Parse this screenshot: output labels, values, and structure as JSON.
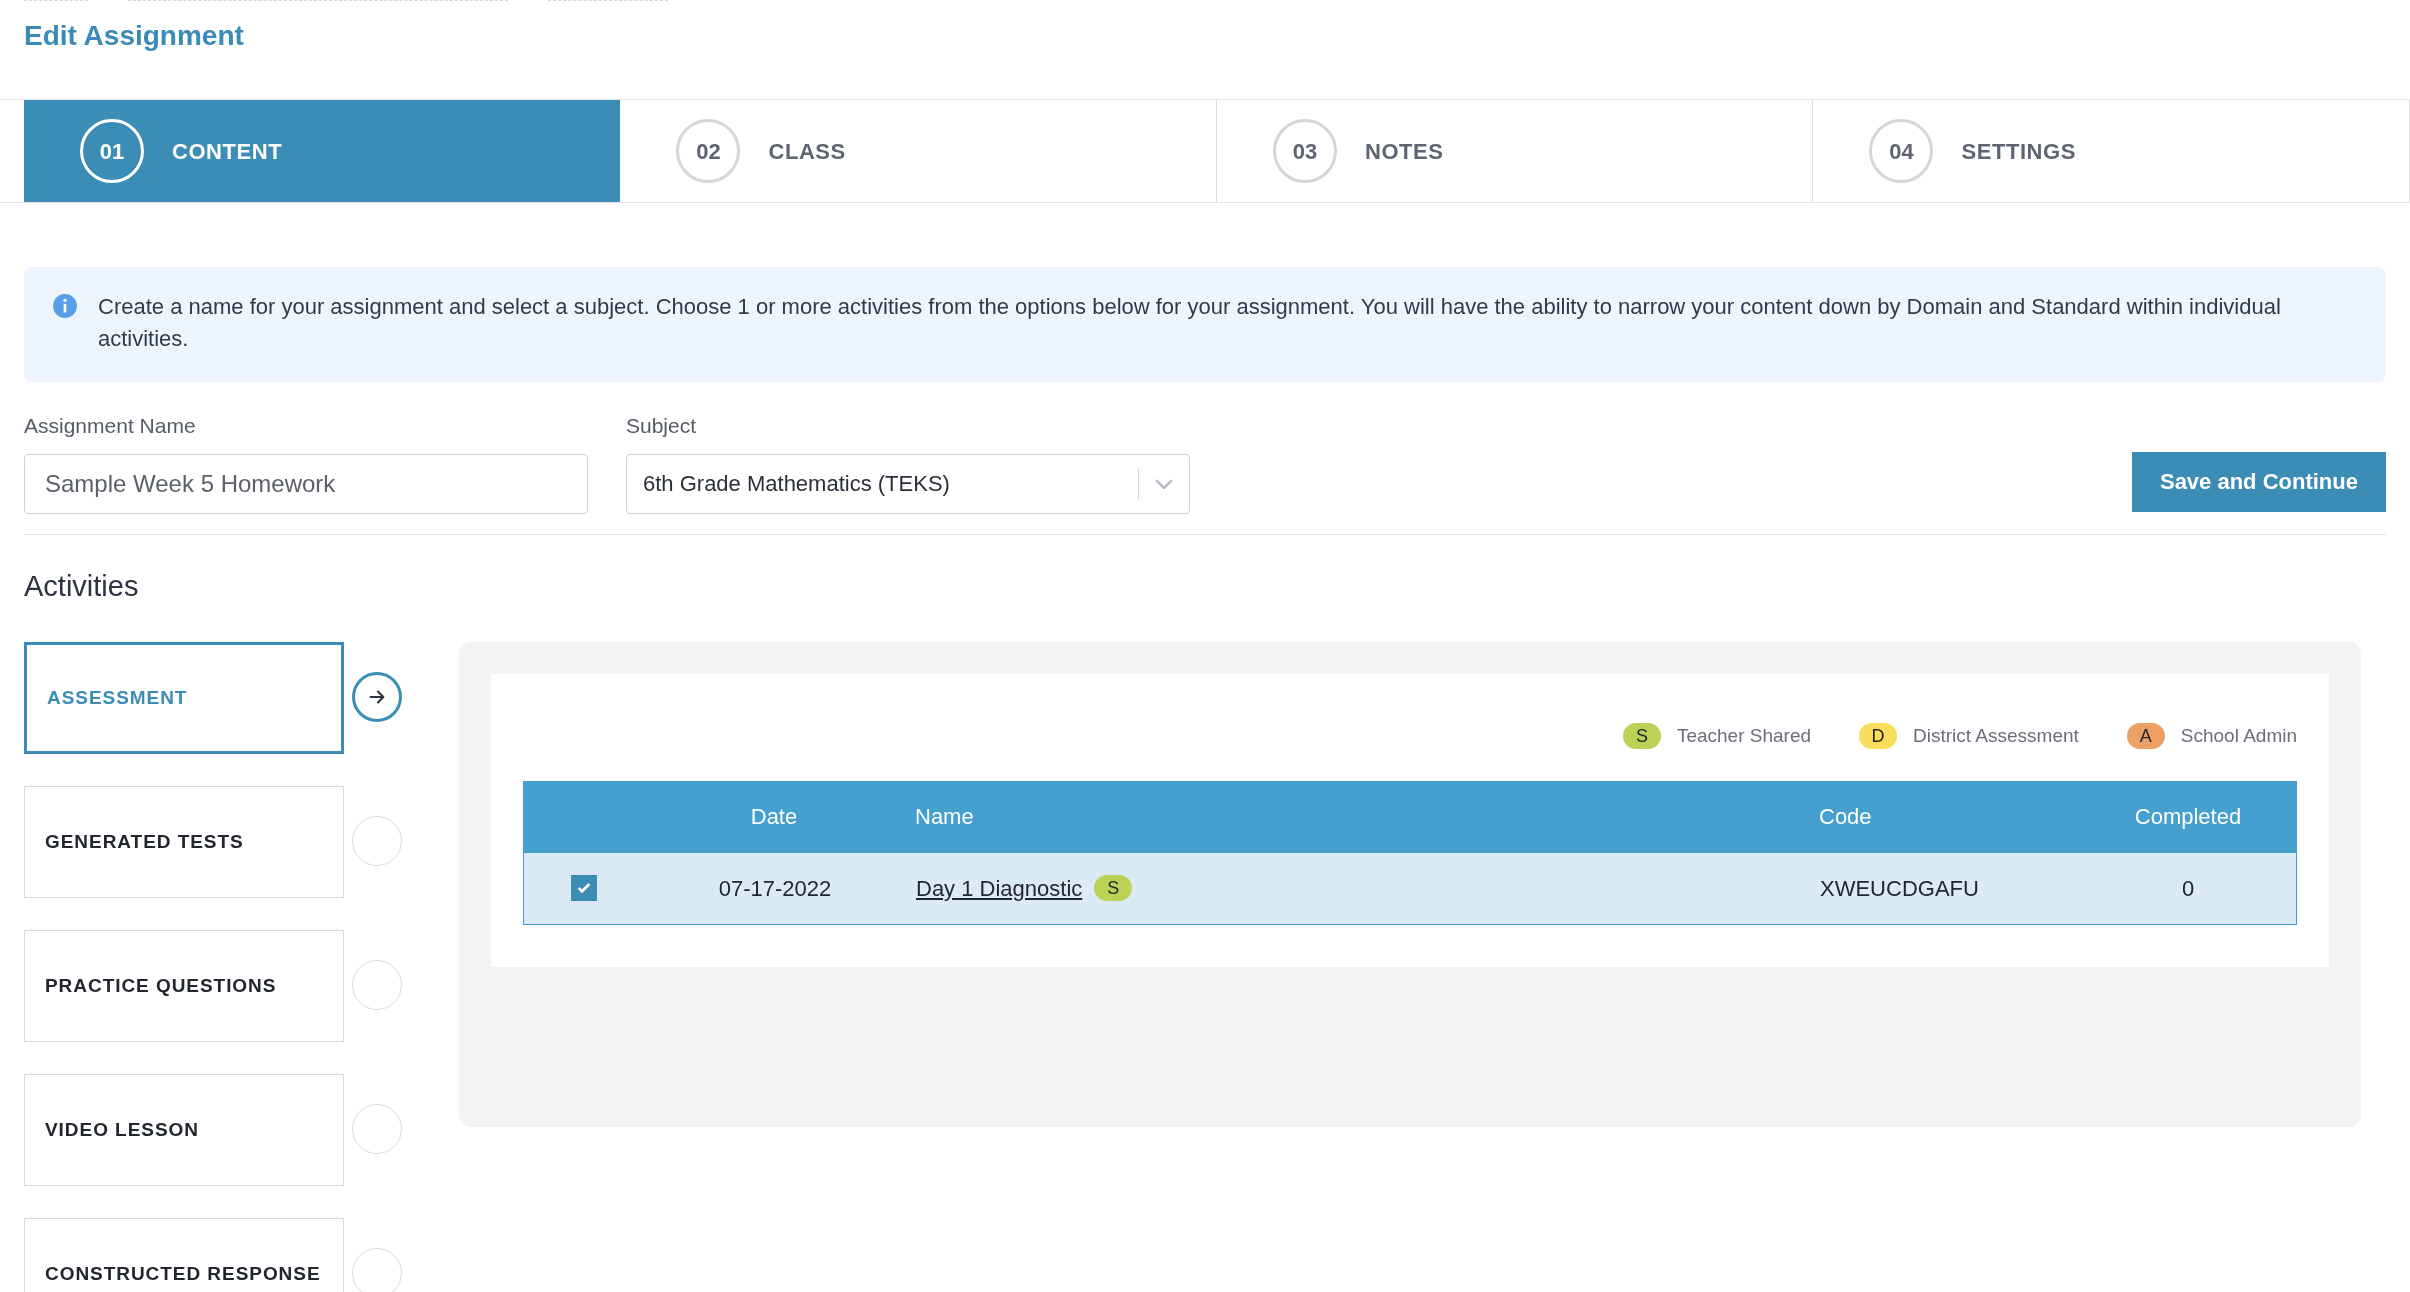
{
  "page_title": "Edit Assignment",
  "steps": [
    {
      "number": "01",
      "label": "CONTENT",
      "selected": true
    },
    {
      "number": "02",
      "label": "CLASS",
      "selected": false
    },
    {
      "number": "03",
      "label": "NOTES",
      "selected": false
    },
    {
      "number": "04",
      "label": "SETTINGS",
      "selected": false
    }
  ],
  "info": "Create a name for your assignment and select a subject. Choose 1 or more activities from the options below for your assignment. You will have the ability to narrow your content down by Domain and Standard within individual activities.",
  "assignment_name": {
    "label": "Assignment Name",
    "value": "Sample Week 5 Homework"
  },
  "subject": {
    "label": "Subject",
    "value": "6th Grade Mathematics (TEKS)"
  },
  "save_button": "Save and Continue",
  "activities_title": "Activities",
  "activities": [
    {
      "label": "ASSESSMENT",
      "selected": true
    },
    {
      "label": "GENERATED TESTS",
      "selected": false
    },
    {
      "label": "PRACTICE QUESTIONS",
      "selected": false
    },
    {
      "label": "VIDEO LESSON",
      "selected": false
    },
    {
      "label": "CONSTRUCTED RESPONSE",
      "selected": false
    }
  ],
  "legend": [
    {
      "letter": "S",
      "label": "Teacher Shared",
      "color": "#bbd256"
    },
    {
      "letter": "D",
      "label": "District Assessment",
      "color": "#f9dc5c"
    },
    {
      "letter": "A",
      "label": "School Admin",
      "color": "#eca064"
    }
  ],
  "table": {
    "columns": [
      "Date",
      "Name",
      "Code",
      "Completed"
    ],
    "rows": [
      {
        "checked": true,
        "selected": true,
        "date": "07-17-2022",
        "name": "Day 1 Diagnostic",
        "badge": {
          "letter": "S",
          "color": "#bbd256"
        },
        "code": "XWEUCDGAFU",
        "completed": "0"
      }
    ]
  }
}
